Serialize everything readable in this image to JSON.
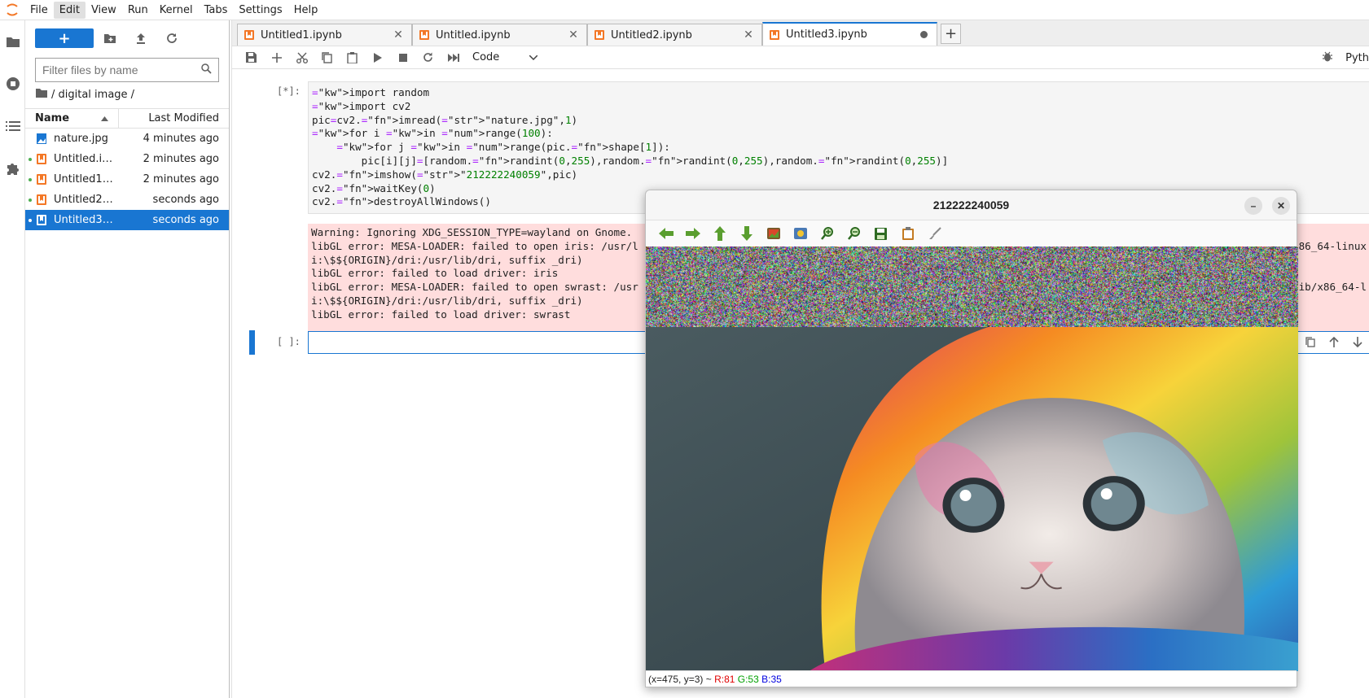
{
  "menubar": {
    "items": [
      "File",
      "Edit",
      "View",
      "Run",
      "Kernel",
      "Tabs",
      "Settings",
      "Help"
    ],
    "active": "Edit"
  },
  "filebrowser": {
    "new_label": "+",
    "filter_placeholder": "Filter files by name",
    "breadcrumb": "/ digital image /",
    "col_name": "Name",
    "col_modified": "Last Modified",
    "files": [
      {
        "name": "nature.jpg",
        "modified": "4 minutes ago",
        "type": "image",
        "running": false,
        "selected": false
      },
      {
        "name": "Untitled.ip…",
        "modified": "2 minutes ago",
        "type": "notebook",
        "running": true,
        "selected": false
      },
      {
        "name": "Untitled1.i…",
        "modified": "2 minutes ago",
        "type": "notebook",
        "running": true,
        "selected": false
      },
      {
        "name": "Untitled2.i…",
        "modified": "seconds ago",
        "type": "notebook",
        "running": true,
        "selected": false
      },
      {
        "name": "Untitled3.i…",
        "modified": "seconds ago",
        "type": "notebook",
        "running": true,
        "selected": true
      }
    ]
  },
  "tabs": [
    {
      "label": "Untitled1.ipynb",
      "active": false,
      "dirty": false
    },
    {
      "label": "Untitled.ipynb",
      "active": false,
      "dirty": false
    },
    {
      "label": "Untitled2.ipynb",
      "active": false,
      "dirty": false
    },
    {
      "label": "Untitled3.ipynb",
      "active": true,
      "dirty": true
    }
  ],
  "notebook_toolbar": {
    "cell_type": "Code",
    "kernel": "Pyth"
  },
  "cells": [
    {
      "prompt": "[*]:",
      "code_lines": [
        "import random",
        "import cv2",
        "pic=cv2.imread(\"nature.jpg\",1)",
        "for i in range(100):",
        "    for j in range(pic.shape[1]):",
        "        pic[i][j]=[random.randint(0,255),random.randint(0,255),random.randint(0,255)]",
        "cv2.imshow(\"212222240059\",pic)",
        "cv2.waitKey(0)",
        "cv2.destroyAllWindows()"
      ],
      "stderr_lines": [
        "Warning: Ignoring XDG_SESSION_TYPE=wayland on Gnome.",
        "libGL error: MESA-LOADER: failed to open iris: /usr/l",
        "i:\\$${ORIGIN}/dri:/usr/lib/dri, suffix _dri)",
        "libGL error: failed to load driver: iris",
        "libGL error: MESA-LOADER: failed to open swrast: /usr",
        "i:\\$${ORIGIN}/dri:/usr/lib/dri, suffix _dri)",
        "libGL error: failed to load driver: swrast"
      ],
      "stderr_tail_1": "86_64-linux",
      "stderr_tail_4": "ib/x86_64-l"
    },
    {
      "prompt": "[ ]:",
      "code_lines": []
    }
  ],
  "cv_window": {
    "title": "212222240059",
    "status_coords": "(x=475, y=3) ~",
    "status_r": "R:81",
    "status_g": "G:53",
    "status_b": "B:35",
    "noise_fraction": 0.19
  },
  "colors": {
    "accent": "#1976d2",
    "stderr_bg": "#ffdddd",
    "keyword": "#008000",
    "string": "#ba2121",
    "function": "#0055aa"
  }
}
